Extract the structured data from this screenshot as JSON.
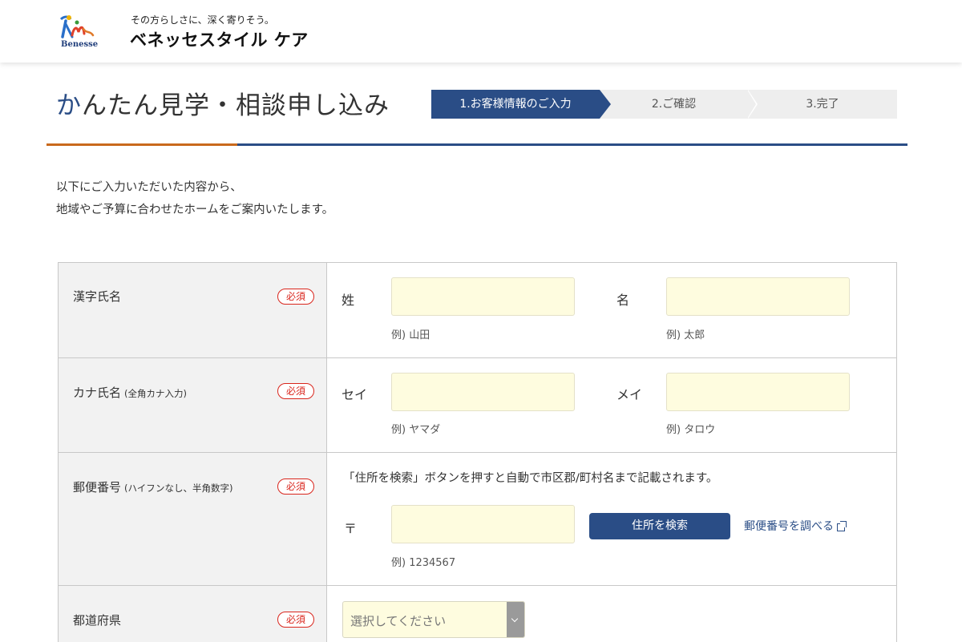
{
  "header": {
    "tagline": "その方らしさに、深く寄りそう。",
    "brand": "ベネッセスタイル ケア",
    "logo_word": "Benesse"
  },
  "page": {
    "title_first": "か",
    "title_rest": "んたん見学・相談申し込み",
    "intro_line1": "以下にご入力いただいた内容から、",
    "intro_line2": "地域やご予算に合わせたホームをご案内いたします。"
  },
  "steps": [
    {
      "label": "1.お客様情報のご入力",
      "active": true
    },
    {
      "label": "2.ご確認",
      "active": false
    },
    {
      "label": "3.完了",
      "active": false
    }
  ],
  "form": {
    "required_label": "必須",
    "kanji_name": {
      "label": "漢字氏名",
      "last_label": "姓",
      "last_example": "例) 山田",
      "first_label": "名",
      "first_example": "例) 太郎"
    },
    "kana_name": {
      "label": "カナ氏名",
      "note": "(全角カナ入力)",
      "last_label": "セイ",
      "last_example": "例) ヤマダ",
      "first_label": "メイ",
      "first_example": "例) タロウ"
    },
    "postal": {
      "label": "郵便番号",
      "note": "(ハイフンなし、半角数字)",
      "guide": "「住所を検索」ボタンを押すと自動で市区郡/町村名まで記載されます。",
      "mark": "〒",
      "example": "例) 1234567",
      "search_button": "住所を検索",
      "lookup_link": "郵便番号を調べる"
    },
    "prefecture": {
      "label": "都道府県",
      "selected": "選択してください"
    }
  },
  "colors": {
    "brand_blue": "#2a4d86",
    "accent_orange": "#c9691c",
    "required_red": "#d9251c",
    "input_bg": "#fefcdf"
  }
}
